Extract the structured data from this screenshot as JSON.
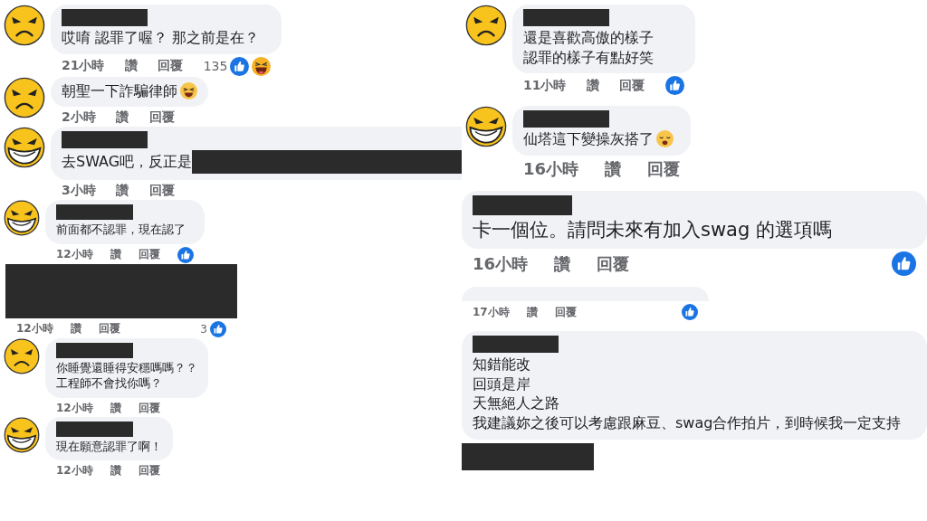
{
  "columns": [
    {
      "comments": [
        {
          "kind": "full",
          "avatar": {
            "kind": "frown"
          },
          "name_hidden": true,
          "text": {
            "kind": "medium",
            "lines": [
              "哎唷 認罪了喔？ 那之前是在？"
            ]
          },
          "meta": {
            "kind": "medium",
            "time": "21小時",
            "like": "讚",
            "reply": "回覆",
            "count": "135",
            "reactions": [
              {
                "kind": "like"
              },
              {
                "kind": "haha"
              }
            ]
          }
        },
        {
          "kind": "full",
          "avatar": {
            "kind": "frown"
          },
          "name_hidden": false,
          "text": {
            "kind": "medium",
            "lines": [
              "朝聖一下詐騙律師"
            ],
            "emoji": {
              "kind": "laugh"
            }
          },
          "meta": {
            "kind": "medium",
            "time": "2小時",
            "like": "讚",
            "reply": "回覆"
          }
        },
        {
          "kind": "cut",
          "avatar": {
            "kind": "grin"
          },
          "name_hidden": true,
          "text": {
            "kind": "medium",
            "lines": [
              "去SWAG吧，反正是"
            ]
          },
          "meta": {
            "kind": "medium",
            "time": "3小時",
            "like": "讚",
            "reply": "回覆"
          }
        },
        {
          "kind": "full",
          "avatar": {
            "kind": "grin"
          },
          "name_hidden": true,
          "text": {
            "kind": "small",
            "lines": [
              "前面都不認罪，現在認了"
            ]
          },
          "meta": {
            "kind": "small",
            "time": "12小時",
            "like": "讚",
            "reply": "回覆",
            "reactions": [
              {
                "kind": "like"
              }
            ]
          }
        },
        {
          "kind": "covered",
          "meta": {
            "kind": "small",
            "time": "12小時",
            "like": "讚",
            "reply": "回覆",
            "count": "3",
            "reactions": [
              {
                "kind": "like"
              }
            ]
          }
        },
        {
          "kind": "full",
          "avatar": {
            "kind": "frown"
          },
          "name_hidden": true,
          "text": {
            "kind": "small",
            "lines": [
              "你睡覺還睡得安穩嗎嗎？？",
              "工程師不會找你嗎？"
            ]
          },
          "meta": {
            "kind": "small",
            "time": "12小時",
            "like": "讚",
            "reply": "回覆"
          }
        },
        {
          "kind": "full",
          "avatar": {
            "kind": "grin"
          },
          "name_hidden": true,
          "text": {
            "kind": "small",
            "lines": [
              "現在願意認罪了啊！"
            ]
          },
          "meta": {
            "kind": "small",
            "time": "12小時",
            "like": "讚",
            "reply": "回覆"
          }
        }
      ]
    },
    {
      "comments": [
        {
          "kind": "full",
          "avatar": {
            "kind": "frown"
          },
          "name_hidden": true,
          "text": {
            "kind": "medium",
            "lines": [
              "還是喜歡高傲的樣子",
              "認罪的樣子有點好笑"
            ]
          },
          "meta": {
            "kind": "medium",
            "time": "11小時",
            "like": "讚",
            "reply": "回覆",
            "reactions": [
              {
                "kind": "like"
              }
            ]
          }
        },
        {
          "kind": "full",
          "avatar": {
            "kind": "grin"
          },
          "name_hidden": true,
          "text": {
            "kind": "medium",
            "lines": [
              "仙塔這下變操灰搭了"
            ],
            "emoji": {
              "kind": "tired"
            }
          },
          "meta": {
            "kind": "large",
            "time": "16小時",
            "like": "讚",
            "reply": "回覆"
          }
        },
        {
          "kind": "wide",
          "name_hidden": true,
          "text": {
            "kind": "large",
            "lines": [
              "卡一個位。請問未來有加入swag 的選項嗎"
            ]
          },
          "meta": {
            "kind": "large",
            "time": "16小時",
            "like": "讚",
            "reply": "回覆",
            "reactions": [
              {
                "kind": "like"
              }
            ]
          }
        },
        {
          "kind": "sliver",
          "meta": {
            "kind": "small",
            "time": "17小時",
            "like": "讚",
            "reply": "回覆",
            "reactions": [
              {
                "kind": "like"
              }
            ]
          }
        },
        {
          "kind": "wide",
          "name_hidden": true,
          "text": {
            "kind": "medium",
            "lines": [
              "知錯能改",
              "回頭是岸",
              "天無絕人之路",
              "我建議妳之後可以考慮跟麻豆、swag合作拍片，到時候我一定支持"
            ]
          },
          "trailing_redaction": true
        }
      ]
    }
  ]
}
